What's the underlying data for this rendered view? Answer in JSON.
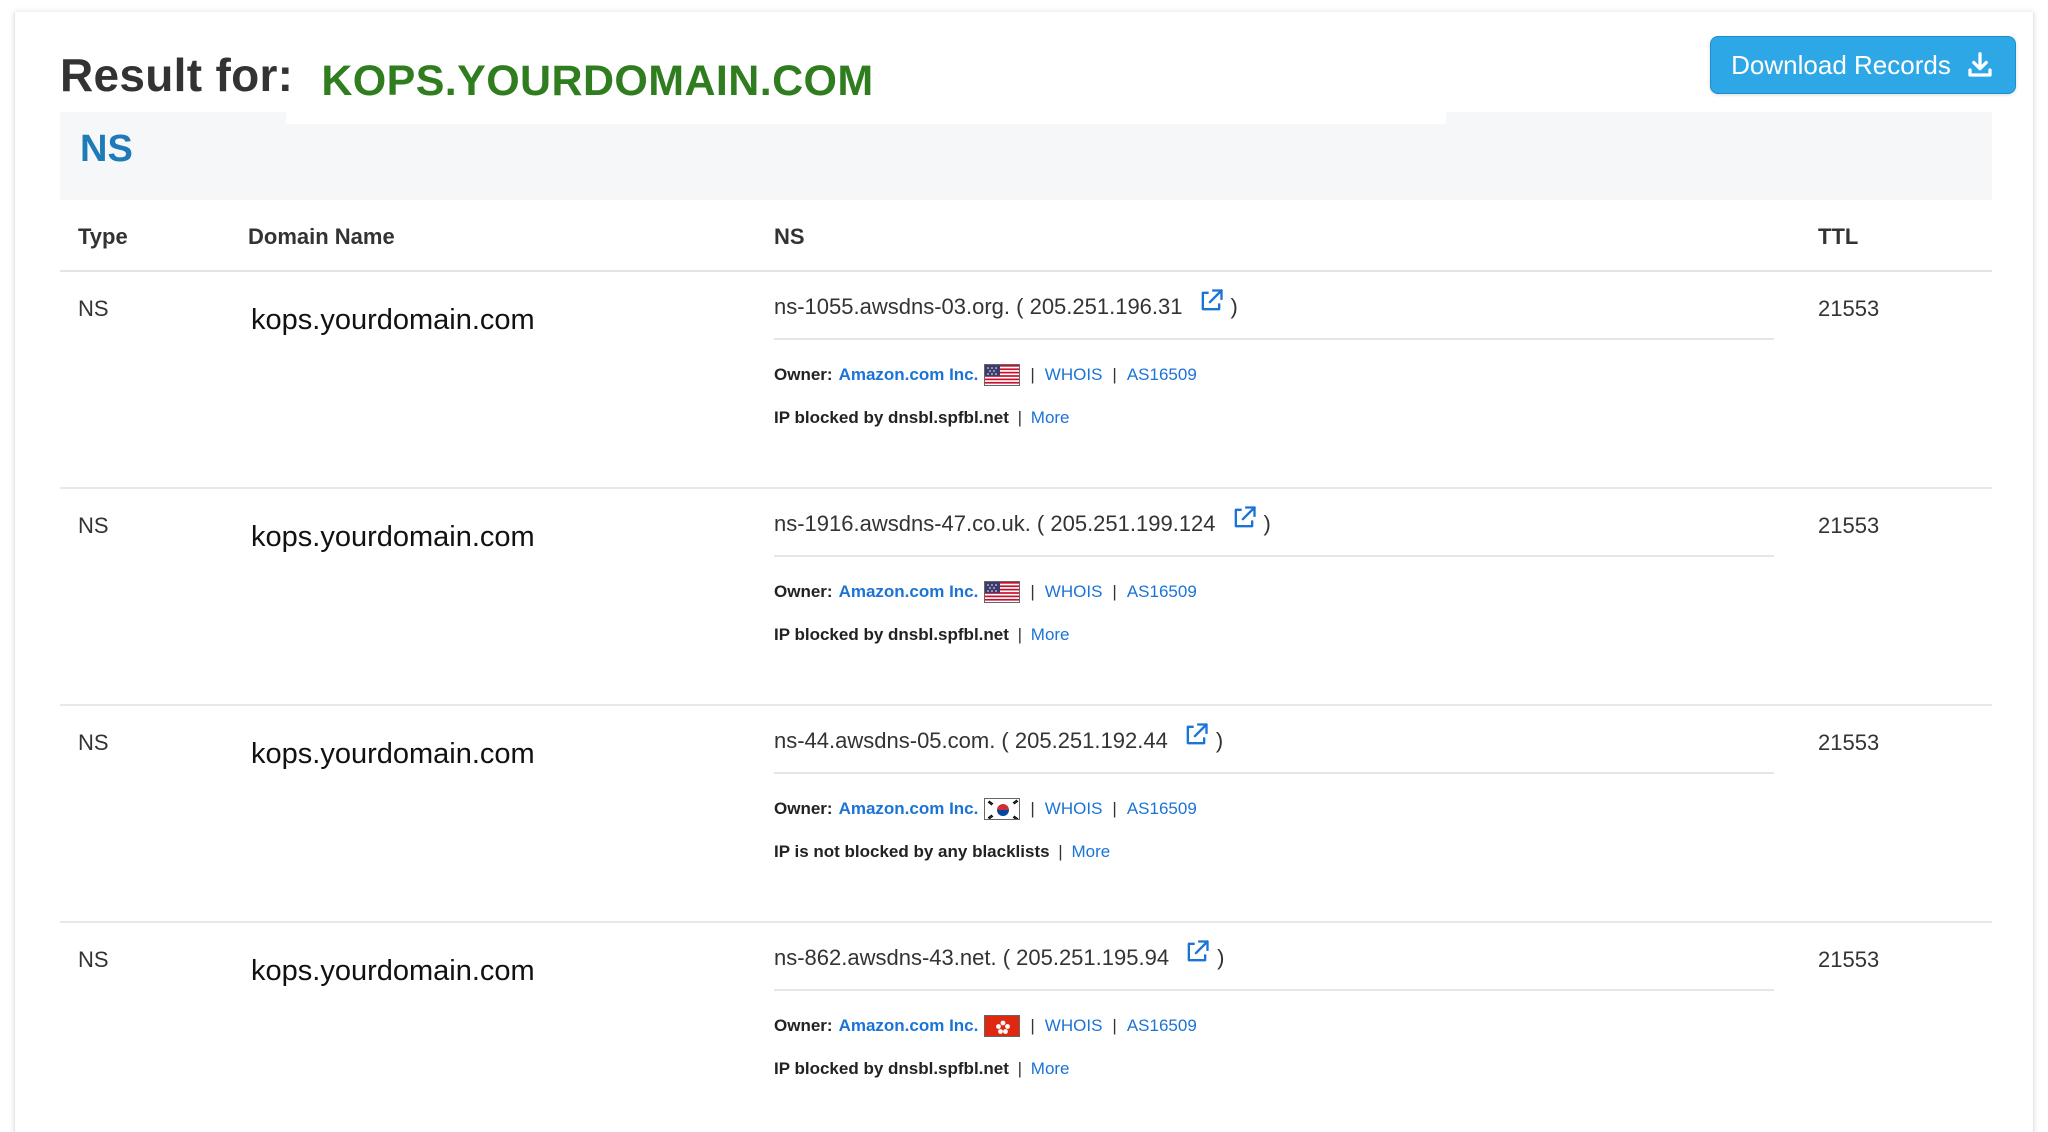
{
  "header": {
    "result_label": "Result for:",
    "domain": "KOPS.YOURDOMAIN.COM",
    "download_label": "Download Records"
  },
  "section": {
    "title": "NS"
  },
  "columns": {
    "type": "Type",
    "domain": "Domain Name",
    "ns": "NS",
    "ttl": "TTL"
  },
  "colors": {
    "accent": "#2ea7e6",
    "domain_green": "#2f7d1f",
    "section_blue": "#1f7ab8",
    "link": "#1a73d6"
  },
  "records": [
    {
      "type": "NS",
      "domain": "kops.yourdomain.com",
      "ns": "ns-1055.awsdns-03.org. ( 205.251.196.31",
      "close": ")",
      "owner_label": "Owner:",
      "owner": "Amazon.com Inc.",
      "flag": "us-flag-icon",
      "whois": "WHOIS",
      "as": "AS16509",
      "status": "IP blocked by dnsbl.spfbl.net",
      "status_sep": "|",
      "more": "More",
      "ttl": "21553"
    },
    {
      "type": "NS",
      "domain": "kops.yourdomain.com",
      "ns": "ns-1916.awsdns-47.co.uk. ( 205.251.199.124",
      "close": ")",
      "owner_label": "Owner:",
      "owner": "Amazon.com Inc.",
      "flag": "us-flag-icon",
      "whois": "WHOIS",
      "as": "AS16509",
      "status": "IP blocked by dnsbl.spfbl.net",
      "status_sep": "|",
      "more": "More",
      "ttl": "21553"
    },
    {
      "type": "NS",
      "domain": "kops.yourdomain.com",
      "ns": "ns-44.awsdns-05.com. ( 205.251.192.44",
      "close": ")",
      "owner_label": "Owner:",
      "owner": "Amazon.com Inc.",
      "flag": "kr-flag-icon",
      "whois": "WHOIS",
      "as": "AS16509",
      "status": "IP is not blocked by any blacklists",
      "status_sep": "|",
      "more": "More",
      "ttl": "21553"
    },
    {
      "type": "NS",
      "domain": "kops.yourdomain.com",
      "ns": "ns-862.awsdns-43.net. ( 205.251.195.94",
      "close": ")",
      "owner_label": "Owner:",
      "owner": "Amazon.com Inc.",
      "flag": "hk-flag-icon",
      "whois": "WHOIS",
      "as": "AS16509",
      "status": "IP blocked by dnsbl.spfbl.net",
      "status_sep": "|",
      "more": "More",
      "ttl": "21553"
    }
  ]
}
